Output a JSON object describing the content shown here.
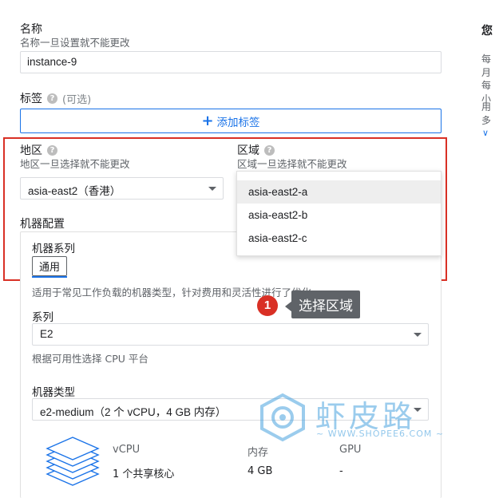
{
  "name_field": {
    "label": "名称",
    "hint": "名称一旦设置就不能更改",
    "value": "instance-9"
  },
  "labels_field": {
    "label": "标签",
    "optional": "(可选)",
    "add_button": "添加标签"
  },
  "region_field": {
    "label": "地区",
    "hint": "地区一旦选择就不能更改",
    "value": "asia-east2（香港）"
  },
  "zone_field": {
    "label": "区域",
    "hint": "区域一旦选择就不能更改",
    "options": [
      "asia-east2-a",
      "asia-east2-b",
      "asia-east2-c"
    ],
    "selected_index": 0
  },
  "machine_config": {
    "label": "机器配置",
    "family_label": "机器系列",
    "family_chip": "通用",
    "family_desc": "适用于常见工作负载的机器类型，针对费用和灵活性进行了优化",
    "series_label": "系列",
    "series_value": "E2",
    "series_hint": "根据可用性选择 CPU 平台",
    "type_label": "机器类型",
    "type_value": "e2-medium（2 个 vCPU，4 GB 内存）",
    "specs": {
      "headers": [
        "vCPU",
        "内存",
        "GPU"
      ],
      "values": [
        "1 个共享核心",
        "4 GB",
        "-"
      ]
    }
  },
  "annotation": {
    "step": "1",
    "text": "选择区域"
  },
  "side_panel": {
    "title": "您",
    "line1": "每月",
    "line2": "每小",
    "line3": "用多"
  },
  "watermark": {
    "brand": "虾皮路",
    "url": "~ WWW.SHOPEE6.COM ~"
  },
  "colors": {
    "accent": "#1a73e8",
    "highlight_box": "#d93025",
    "tooltip_bg": "#5f6368"
  }
}
